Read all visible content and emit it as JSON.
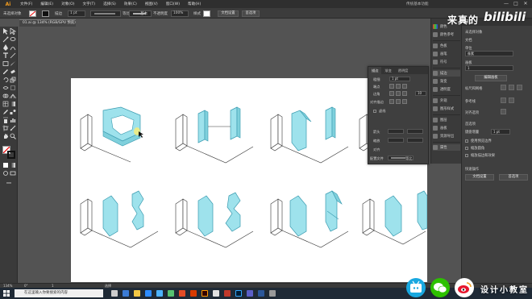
{
  "app": {
    "logo": "Ai",
    "menus": [
      "文件(F)",
      "编辑(E)",
      "对象(O)",
      "文字(T)",
      "选择(S)",
      "效果(C)",
      "视图(V)",
      "窗口(W)",
      "帮助(H)"
    ],
    "workspace_label": "传统基本功能",
    "window_controls": [
      "—",
      "□",
      "✕"
    ]
  },
  "controlbar": {
    "selection_label": "未选择对象",
    "stroke_label": "描边",
    "stroke_value": "1 pt",
    "uniform_label": "等比",
    "brush_value": "基本",
    "opacity_label": "不透明度",
    "opacity_value": "100%",
    "style_label": "样式",
    "doc_setup_button": "文档设置",
    "preferences_button": "首选项"
  },
  "document": {
    "tab_title": "01.ai @ 134% (RGB/GPU 预览)",
    "close": "×"
  },
  "stroke_panel": {
    "tabs": [
      "描边",
      "渐变",
      "透明度"
    ],
    "weight_label": "粗细",
    "weight_value": "1 pt",
    "cap_label": "端点",
    "corner_label": "边角",
    "limit_value": "10",
    "align_label": "对齐描边",
    "dashed_label": "虚线",
    "arrow_label": "箭头",
    "scale_label": "缩放",
    "align_label2": "对齐",
    "profile_label": "配置文件",
    "profile_value": "等比"
  },
  "dock": {
    "items": [
      {
        "label": "颜色",
        "icon": "color-icon"
      },
      {
        "label": "颜色参考",
        "icon": "color-guide-icon"
      },
      {
        "label": "色板",
        "icon": "swatches-icon"
      },
      {
        "label": "画笔",
        "icon": "brushes-icon"
      },
      {
        "label": "符号",
        "icon": "symbols-icon"
      },
      {
        "label": "描边",
        "icon": "stroke-icon"
      },
      {
        "label": "渐变",
        "icon": "gradient-icon"
      },
      {
        "label": "透明度",
        "icon": "transparency-icon"
      },
      {
        "label": "外观",
        "icon": "appearance-icon"
      },
      {
        "label": "图形样式",
        "icon": "graphic-styles-icon"
      },
      {
        "label": "图层",
        "icon": "layers-icon"
      },
      {
        "label": "画板",
        "icon": "artboards-icon"
      },
      {
        "label": "资源导出",
        "icon": "asset-export-icon"
      },
      {
        "label": "属性",
        "icon": "properties-icon"
      }
    ]
  },
  "properties": {
    "header": "属性",
    "no_selection": "未选择对象",
    "document_label": "文档",
    "unit_label": "单位",
    "unit_value": "像素",
    "artboard_label": "画板",
    "artboard_value": "1",
    "edit_artboard_button": "编辑画板",
    "ruler_grid_label": "标尺和网格",
    "guides_label": "参考线",
    "align_label": "对齐选项",
    "preferences_label": "首选项",
    "keyboard_increment_label": "键盘增量",
    "keyboard_increment_value": "1 pt",
    "use_preview_bounds": "使用预览边界",
    "scale_corners": "缩放圆角",
    "scale_strokes": "缩放描边和效果",
    "quick_actions_label": "快速操作",
    "doc_setup_button": "文档设置",
    "preferences_button": "首选项"
  },
  "statusbar": {
    "zoom": "134%",
    "rotation": "0°",
    "artboard_nav": "1",
    "tool_name": "选择"
  },
  "taskbar": {
    "search_placeholder": "在这里输入你要搜索的内容"
  },
  "watermark": {
    "top_text": "来真的",
    "top_logo": "bilibili",
    "brand": "设计小教室"
  },
  "colors": {
    "cyan_fill": "#9ee2ec",
    "cyan_stroke": "#3a9bb0",
    "artboard": "#ffffff",
    "workspace": "#535353",
    "panel": "#3f3f3f"
  }
}
